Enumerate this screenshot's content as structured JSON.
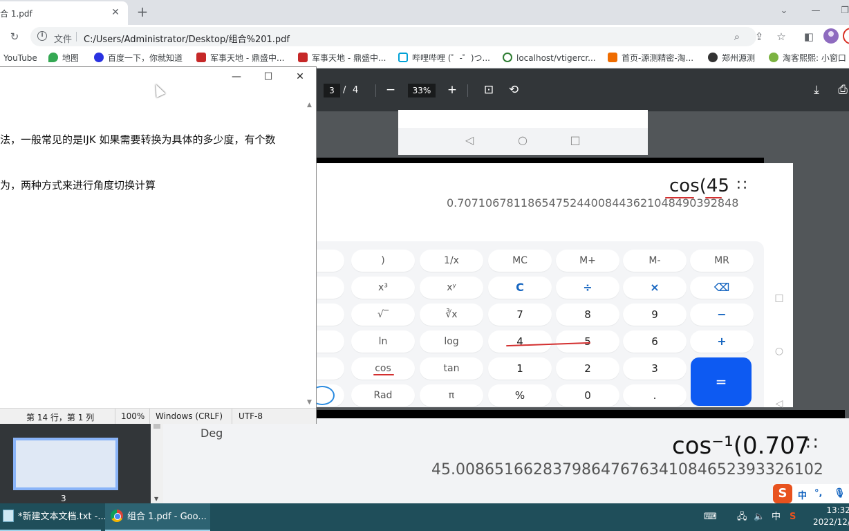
{
  "browser": {
    "tab_title": "合 1.pdf",
    "omnibox_label": "文件",
    "url": "C:/Users/Administrator/Desktop/组合%201.pdf",
    "bookmarks": [
      {
        "label": "YouTube",
        "color": "#ff0000"
      },
      {
        "label": "地图",
        "color": "#34a853"
      },
      {
        "label": "百度一下，你就知道",
        "color": "#2932e1"
      },
      {
        "label": "军事天地 - 鼎盛中...",
        "color": "#c62828"
      },
      {
        "label": "军事天地 - 鼎盛中...",
        "color": "#c62828"
      },
      {
        "label": "哔哩哔哩 (゜-゜)つ...",
        "color": "#00a1d6"
      },
      {
        "label": "localhost/vtigercr...",
        "color": "#2e7d32"
      },
      {
        "label": "首页-源测精密-淘...",
        "color": "#ef6c00"
      },
      {
        "label": "郑州源测",
        "color": "#333333"
      },
      {
        "label": "淘客熙熙: 小窗口",
        "color": "#7cb342"
      }
    ]
  },
  "pdf": {
    "current_page": "3",
    "page_separator": "/",
    "total_pages": "4",
    "zoom": "33%",
    "thumb_page_number": "3"
  },
  "calculator_top": {
    "expression": "cos(45",
    "result": "0.70710678118654752440084436210484903928​48",
    "keys": [
      {
        "label": ")",
        "row": 0,
        "col": 1,
        "kind": "fn"
      },
      {
        "label": "1/x",
        "row": 0,
        "col": 2,
        "kind": "fn"
      },
      {
        "label": "MC",
        "row": 0,
        "col": 3,
        "kind": "fn"
      },
      {
        "label": "M+",
        "row": 0,
        "col": 4,
        "kind": "fn"
      },
      {
        "label": "M-",
        "row": 0,
        "col": 5,
        "kind": "fn"
      },
      {
        "label": "MR",
        "row": 0,
        "col": 6,
        "kind": "fn"
      },
      {
        "label": "x³",
        "row": 1,
        "col": 1,
        "kind": "fn"
      },
      {
        "label": "xʸ",
        "row": 1,
        "col": 2,
        "kind": "fn"
      },
      {
        "label": "C",
        "row": 1,
        "col": 3,
        "kind": "op"
      },
      {
        "label": "÷",
        "row": 1,
        "col": 4,
        "kind": "op"
      },
      {
        "label": "×",
        "row": 1,
        "col": 5,
        "kind": "op"
      },
      {
        "label": "⌫",
        "row": 1,
        "col": 6,
        "kind": "op"
      },
      {
        "label": "√‾",
        "row": 2,
        "col": 1,
        "kind": "fn"
      },
      {
        "label": "∛x",
        "row": 2,
        "col": 2,
        "kind": "fn"
      },
      {
        "label": "7",
        "row": 2,
        "col": 3,
        "kind": "num"
      },
      {
        "label": "8",
        "row": 2,
        "col": 4,
        "kind": "num"
      },
      {
        "label": "9",
        "row": 2,
        "col": 5,
        "kind": "num"
      },
      {
        "label": "−",
        "row": 2,
        "col": 6,
        "kind": "op"
      },
      {
        "label": "ln",
        "row": 3,
        "col": 1,
        "kind": "fn"
      },
      {
        "label": "log",
        "row": 3,
        "col": 2,
        "kind": "fn"
      },
      {
        "label": "4",
        "row": 3,
        "col": 3,
        "kind": "num"
      },
      {
        "label": "5",
        "row": 3,
        "col": 4,
        "kind": "num"
      },
      {
        "label": "6",
        "row": 3,
        "col": 5,
        "kind": "num"
      },
      {
        "label": "+",
        "row": 3,
        "col": 6,
        "kind": "op"
      },
      {
        "label": "cos",
        "row": 4,
        "col": 1,
        "kind": "fn"
      },
      {
        "label": "tan",
        "row": 4,
        "col": 2,
        "kind": "fn"
      },
      {
        "label": "1",
        "row": 4,
        "col": 3,
        "kind": "num"
      },
      {
        "label": "2",
        "row": 4,
        "col": 4,
        "kind": "num"
      },
      {
        "label": "3",
        "row": 4,
        "col": 5,
        "kind": "num"
      },
      {
        "label": "Rad",
        "row": 5,
        "col": 1,
        "kind": "fn"
      },
      {
        "label": "π",
        "row": 5,
        "col": 2,
        "kind": "fn"
      },
      {
        "label": "%",
        "row": 5,
        "col": 3,
        "kind": "num"
      },
      {
        "label": "0",
        "row": 5,
        "col": 4,
        "kind": "num"
      },
      {
        "label": ".",
        "row": 5,
        "col": 5,
        "kind": "num"
      }
    ],
    "equals": "="
  },
  "calculator_bottom": {
    "mode": "Deg",
    "expression": "cos⁻¹(0.707",
    "result": "45.00865166283798647676341084652393326102"
  },
  "notepad": {
    "lines": [
      "法，一般常见的是IJK 如果需要转换为具体的多少度，有个数",
      "为，两种方式来进行角度切换计算"
    ],
    "status_position": "第 14 行，第 1 列",
    "status_zoom": "100%",
    "status_eol": "Windows (CRLF)",
    "status_encoding": "UTF-8"
  },
  "taskbar": {
    "items": [
      {
        "label": "*新建文本文档.txt -..."
      },
      {
        "label": "组合 1.pdf - Goo..."
      }
    ],
    "ime_lang": "中",
    "time": "13:32",
    "date": "2022/12/"
  },
  "ime_bar": {
    "zh": "中",
    "punct": "°,"
  }
}
